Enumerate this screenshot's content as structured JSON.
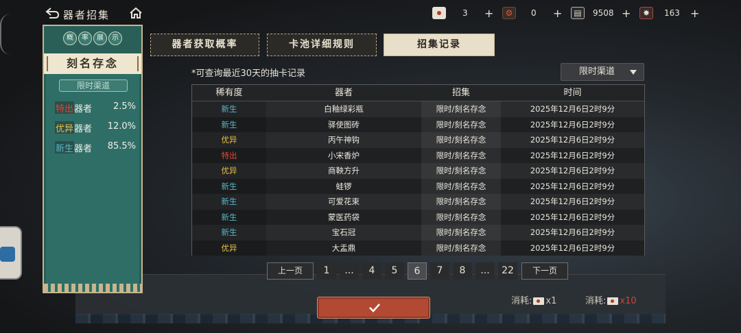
{
  "header": {
    "title": "器者招集",
    "resources": [
      {
        "icon": "envelope-icon",
        "value": "3"
      },
      {
        "icon": "gear-coin-icon",
        "value": "0"
      },
      {
        "icon": "scroll-coin-icon",
        "value": "9508"
      },
      {
        "icon": "ticket-icon",
        "value": "163"
      }
    ]
  },
  "left_panel": {
    "badge_chars": [
      "概",
      "率",
      "展",
      "示"
    ],
    "banner": "刻名存念",
    "channel": "限时渠道",
    "rates": [
      {
        "tag": "特出",
        "suffix": "器者",
        "value": "2.5%",
        "color": "#e0463b"
      },
      {
        "tag": "优异",
        "suffix": "器者",
        "value": "12.0%",
        "color": "#e7c24a"
      },
      {
        "tag": "新生",
        "suffix": "器者",
        "value": "85.5%",
        "color": "#56b7c9"
      }
    ]
  },
  "tabs": [
    {
      "label": "器者获取概率",
      "active": false
    },
    {
      "label": "卡池详细规则",
      "active": false
    },
    {
      "label": "招集记录",
      "active": true
    }
  ],
  "main": {
    "note": "*可查询最近30天的抽卡记录",
    "dropdown_value": "限时渠道",
    "columns": [
      "稀有度",
      "器者",
      "招集",
      "时间"
    ],
    "rows": [
      {
        "rarity": "新生",
        "name": "白釉绿彩瓶",
        "channel": "限时/刻名存念",
        "time": "2025年12月6日2时9分"
      },
      {
        "rarity": "新生",
        "name": "驿使图砖",
        "channel": "限时/刻名存念",
        "time": "2025年12月6日2时9分"
      },
      {
        "rarity": "优异",
        "name": "丙午神钩",
        "channel": "限时/刻名存念",
        "time": "2025年12月6日2时9分"
      },
      {
        "rarity": "特出",
        "name": "小宋香炉",
        "channel": "限时/刻名存念",
        "time": "2025年12月6日2时9分"
      },
      {
        "rarity": "优异",
        "name": "商鞅方升",
        "channel": "限时/刻名存念",
        "time": "2025年12月6日2时9分"
      },
      {
        "rarity": "新生",
        "name": "蛙锣",
        "channel": "限时/刻名存念",
        "time": "2025年12月6日2时9分"
      },
      {
        "rarity": "新生",
        "name": "可爱花束",
        "channel": "限时/刻名存念",
        "time": "2025年12月6日2时9分"
      },
      {
        "rarity": "新生",
        "name": "蒙医药袋",
        "channel": "限时/刻名存念",
        "time": "2025年12月6日2时9分"
      },
      {
        "rarity": "新生",
        "name": "宝石冠",
        "channel": "限时/刻名存念",
        "time": "2025年12月6日2时9分"
      },
      {
        "rarity": "优异",
        "name": "大盂鼎",
        "channel": "限时/刻名存念",
        "time": "2025年12月6日2时9分"
      }
    ],
    "rarity_colors": {
      "新生": "#56b7c9",
      "优异": "#e7c24a",
      "特出": "#e0463b"
    }
  },
  "pagination": {
    "prev": "上一页",
    "next": "下一页",
    "items": [
      "1",
      "...",
      "4",
      "5",
      "6",
      "7",
      "8",
      "...",
      "22"
    ],
    "current": "6"
  },
  "background": {
    "cost_label": "消耗:",
    "cost_left": "x1",
    "cost_right": "x10"
  }
}
